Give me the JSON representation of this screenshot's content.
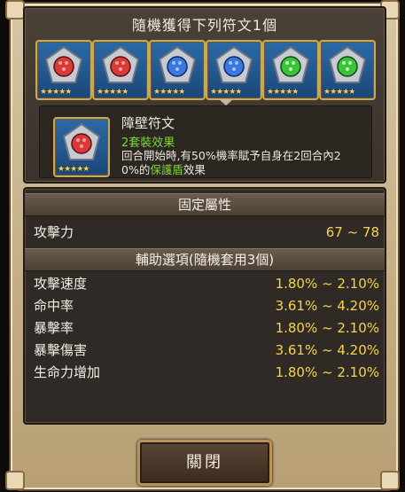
{
  "dialog": {
    "title": "隨機獲得下列符文1個",
    "runes": [
      {
        "color": "red",
        "gem": "#d83a3a",
        "stars": "★★★★★"
      },
      {
        "color": "red",
        "gem": "#d83a3a",
        "stars": "★★★★★"
      },
      {
        "color": "blue",
        "gem": "#3a78e0",
        "stars": "★★★★★"
      },
      {
        "color": "blue",
        "gem": "#3a78e0",
        "stars": "★★★★★"
      },
      {
        "color": "green",
        "gem": "#3cc23a",
        "stars": "★★★★★"
      },
      {
        "color": "green",
        "gem": "#3cc23a",
        "stars": "★★★★★"
      }
    ],
    "selected": {
      "name": "障壁符文",
      "set_label": "2套裝效果",
      "desc_part1": "回合開始時,有50%機率賦予自身在2回合內2",
      "desc_part2": "0%的",
      "desc_highlight": "保護盾",
      "desc_part3": "效果",
      "stars": "★★★★★"
    },
    "fixed_header": "固定屬性",
    "fixed_stats": [
      {
        "label": "攻擊力",
        "value": "67 ~ 78"
      }
    ],
    "aux_header": "輔助選項(隨機套用3個)",
    "aux_stats": [
      {
        "label": "攻擊速度",
        "value": "1.80% ~ 2.10%"
      },
      {
        "label": "命中率",
        "value": "3.61% ~ 4.20%"
      },
      {
        "label": "暴擊率",
        "value": "1.80% ~ 2.10%"
      },
      {
        "label": "暴擊傷害",
        "value": "3.61% ~ 4.20%"
      },
      {
        "label": "生命力增加",
        "value": "1.80% ~ 2.10%"
      }
    ],
    "close_label": "關閉"
  },
  "colors": {
    "stat_value": "#f7d34c",
    "set_green": "#7fd43a",
    "frame_gold": "#c9a85a"
  }
}
